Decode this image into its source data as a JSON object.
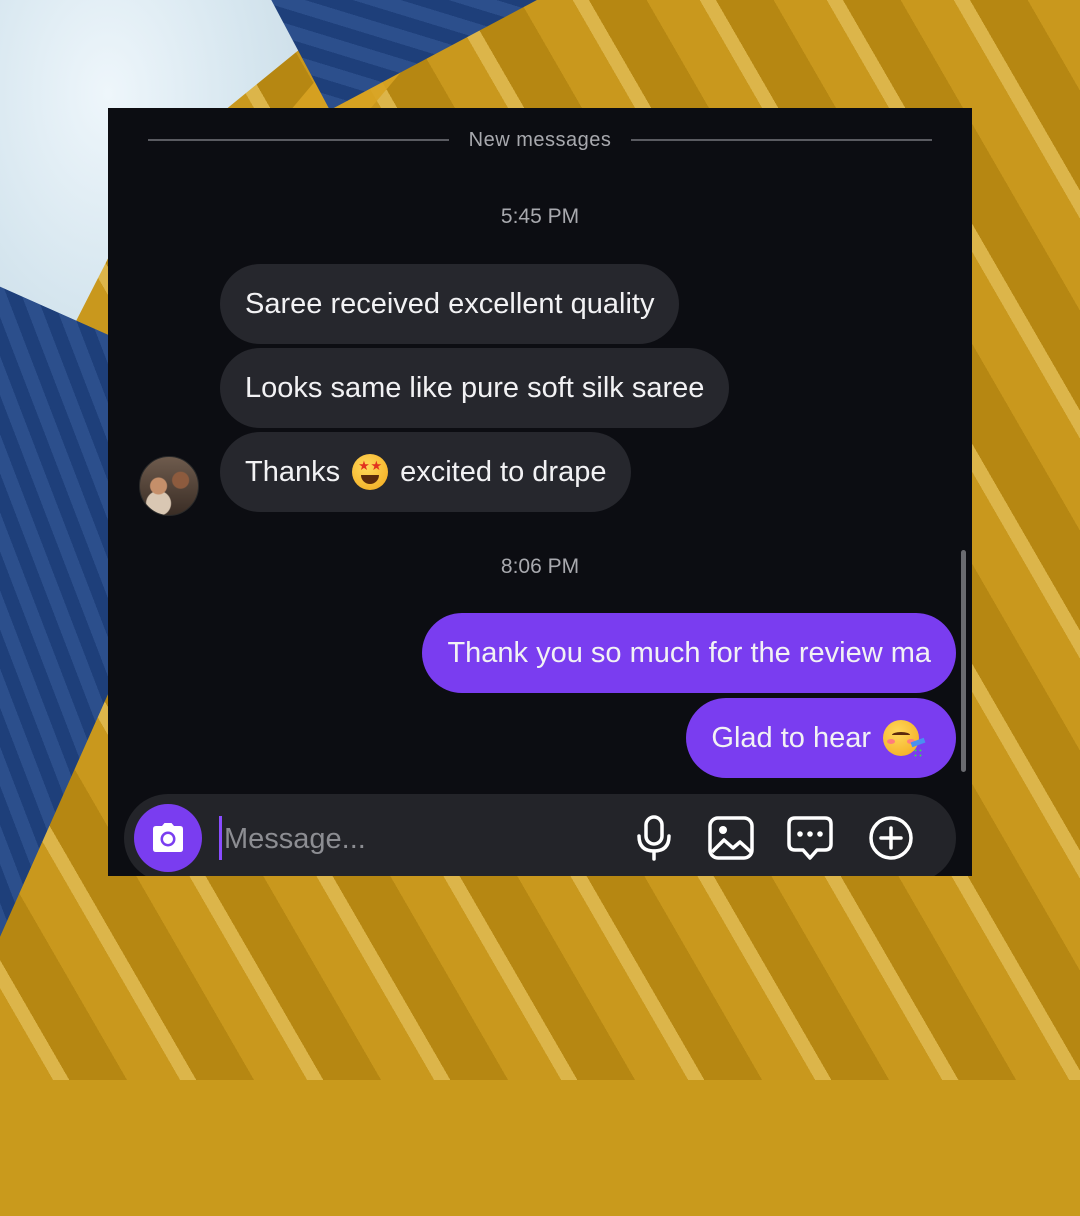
{
  "chat": {
    "divider_label": "New messages",
    "groups": [
      {
        "timestamp": "5:45 PM",
        "messages": [
          {
            "text": "Saree received excellent quality"
          },
          {
            "text": "Looks same like pure soft silk saree"
          },
          {
            "text_before": "Thanks",
            "emoji": "star-struck-emoji",
            "text_after": "excited to drape"
          }
        ]
      },
      {
        "timestamp": "8:06 PM",
        "messages": [
          {
            "text": "Thank you so much for the review ma"
          },
          {
            "text": "Glad to hear",
            "emoji": "partying-face-emoji"
          }
        ]
      }
    ]
  },
  "composer": {
    "placeholder": "Message...",
    "tools": [
      "camera-icon",
      "microphone-icon",
      "gallery-icon",
      "sticker-icon",
      "add-icon"
    ]
  },
  "colors": {
    "chat_background": "#0c0d12",
    "incoming_bubble": "#26272d",
    "outgoing_bubble": "#7a3df0",
    "text": "#f2f2f4",
    "muted_text": "#a8a9ae"
  }
}
